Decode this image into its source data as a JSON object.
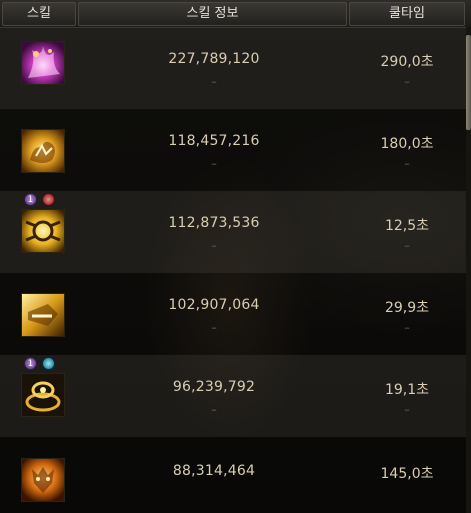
{
  "header": {
    "skill": "스킬",
    "info": "스킬 정보",
    "cooldown": "쿨타임"
  },
  "rows": [
    {
      "icon": "purple-flame-skill-icon",
      "damage": "227,789,120",
      "cooldown": "290,0초",
      "damage_sub": "–",
      "cooldown_sub": "–"
    },
    {
      "icon": "golden-flame-burst-icon",
      "damage": "118,457,216",
      "cooldown": "180,0초",
      "damage_sub": "–",
      "cooldown_sub": "–"
    },
    {
      "icon": "golden-gear-skill-icon",
      "damage": "112,873,536",
      "cooldown": "12,5초",
      "damage_sub": "–",
      "cooldown_sub": "–",
      "badges": [
        "purple-rune-badge",
        "red-rune-badge"
      ],
      "badge_label": "1"
    },
    {
      "icon": "golden-strike-skill-icon",
      "damage": "102,907,064",
      "cooldown": "29,9초",
      "damage_sub": "–",
      "cooldown_sub": "–"
    },
    {
      "icon": "golden-ring-skill-icon",
      "damage": "96,239,792",
      "cooldown": "19,1초",
      "damage_sub": "–",
      "cooldown_sub": "–",
      "badges": [
        "purple-rune-badge",
        "cyan-rune-badge"
      ],
      "badge_label": "1"
    },
    {
      "icon": "golden-lion-skill-icon",
      "damage": "88,314,464",
      "cooldown": "145,0초",
      "damage_sub": "",
      "cooldown_sub": ""
    }
  ],
  "colors": {
    "text": "#d9cdb3",
    "header_text": "#e6e1d6",
    "dash": "#6e6658"
  }
}
